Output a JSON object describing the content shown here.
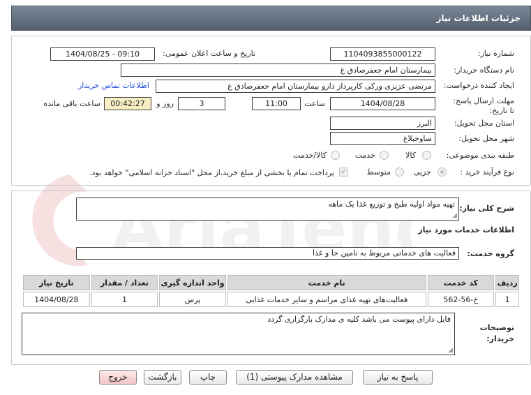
{
  "header": {
    "title": "جزئیات اطلاعات نیاز"
  },
  "form": {
    "need_number_label": "شماره نیاز:",
    "need_number": "1104093855000122",
    "announce_label": "تاریخ و ساعت اعلان عمومی:",
    "announce_value": "1404/08/25 - 09:10",
    "buyer_org_label": "نام دستگاه خریدار:",
    "buyer_org": "بیمارستان امام جعفرصادق ع",
    "creator_label": "ایجاد کننده درخواست:",
    "creator": "مرتضی عزیزی ورکی کارپرداز دارو بیمارستان امام جعفرصادق ع",
    "contact_link": "اطلاعات تماس خریدار",
    "deadline_label": "مهلت ارسال پاسخ: تا تاریخ:",
    "deadline_date": "1404/08/28",
    "time_label": "ساعت",
    "deadline_time": "11:00",
    "days_value": "3",
    "days_label": "روز و",
    "remaining_value": "00:42:27",
    "remaining_label": "ساعت باقی مانده",
    "province_label": "استان محل تحویل:",
    "province": "البرز",
    "city_label": "شهر محل تحویل:",
    "city": "ساوجبلاغ",
    "category_label": "طبقه بندی موضوعی:",
    "category_options": [
      "کالا",
      "خدمت",
      "کالا/خدمت"
    ],
    "process_label": "نوع فرآیند خرید :",
    "process_options": [
      "جزیی",
      "متوسط"
    ],
    "treasury_note": "پرداخت تمام یا بخشی از مبلغ خرید،از محل \"اسناد خزانه اسلامی\" خواهد بود."
  },
  "details": {
    "summary_label": "شرح کلی نیاز:",
    "summary": "تهیه مواد اولیه طبخ و توزیع غذا یک ماهه",
    "services_heading": "اطلاعات خدمات مورد نیاز",
    "service_group_label": "گروه خدمت:",
    "service_group": "فعالیت های خدماتی مربوط به تامین جا و غذا",
    "table": {
      "headers": [
        "ردیف",
        "کد خدمت",
        "نام خدمت",
        "واحد اندازه گیری",
        "تعداد / مقدار",
        "تاریخ نیاز"
      ],
      "rows": [
        [
          "1",
          "خ-56-562",
          "فعالیت‌های تهیه غذای مراسم و سایر خدمات غذایی",
          "پرس",
          "1",
          "1404/08/28"
        ]
      ]
    },
    "buyer_notes_label": "توضیحات خریدار:",
    "buyer_notes": "فایل دارای پیوست می باشد کلیه ی مدارک بارگزاری گردد"
  },
  "buttons": {
    "reply": "پاسخ به نیاز",
    "attachments": "مشاهده مدارک پیوستی (1)",
    "print": "چاپ",
    "back": "بازگشت",
    "exit": "خروج"
  },
  "watermark": {
    "text": "AriaTender.net"
  },
  "colors": {
    "header": "#627080",
    "link": "#1e4fd6",
    "remaining_bg": "#f6efc4",
    "exit_bg": "#f3c6c6"
  }
}
